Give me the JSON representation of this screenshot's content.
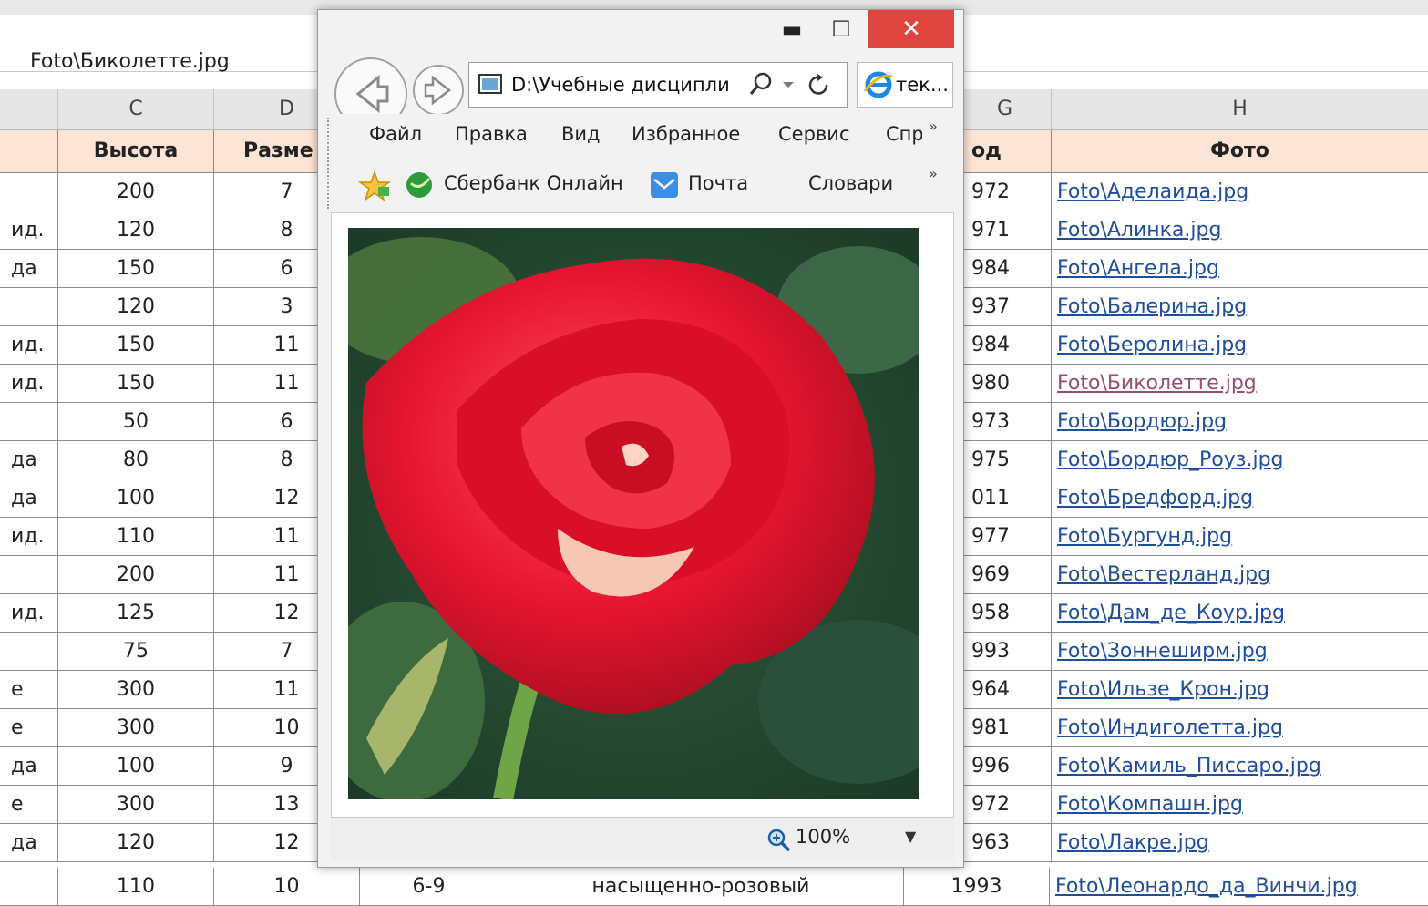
{
  "excel": {
    "formula_bar": "Foto\\Биколетте.jpg",
    "columns": [
      "C",
      "D",
      "G",
      "H"
    ],
    "headers": [
      "Высота",
      "Разме",
      "од",
      "Фото"
    ],
    "rows": [
      {
        "b": "",
        "c": "200",
        "d": "7",
        "g": "972",
        "h": "Foto\\Аделаида.jpg"
      },
      {
        "b": "ид.",
        "c": "120",
        "d": "8",
        "g": "971",
        "h": "Foto\\Алинка.jpg"
      },
      {
        "b": "да",
        "c": "150",
        "d": "6",
        "g": "984",
        "h": "Foto\\Ангела.jpg"
      },
      {
        "b": "",
        "c": "120",
        "d": "3",
        "g": "937",
        "h": "Foto\\Балерина.jpg"
      },
      {
        "b": "ид.",
        "c": "150",
        "d": "11",
        "g": "984",
        "h": "Foto\\Беролина.jpg"
      },
      {
        "b": "ид.",
        "c": "150",
        "d": "11",
        "g": "980",
        "h": "Foto\\Биколетте.jpg"
      },
      {
        "b": "",
        "c": "50",
        "d": "6",
        "g": "973",
        "h": "Foto\\Бордюр.jpg"
      },
      {
        "b": "да",
        "c": "80",
        "d": "8",
        "g": "975",
        "h": "Foto\\Бордюр_Роуз.jpg"
      },
      {
        "b": "да",
        "c": "100",
        "d": "12",
        "g": "011",
        "h": "Foto\\Бредфорд.jpg"
      },
      {
        "b": "ид.",
        "c": "110",
        "d": "11",
        "g": "977",
        "h": "Foto\\Бургунд.jpg"
      },
      {
        "b": "",
        "c": "200",
        "d": "11",
        "g": "969",
        "h": "Foto\\Вестерланд.jpg"
      },
      {
        "b": "ид.",
        "c": "125",
        "d": "12",
        "g": "958",
        "h": "Foto\\Дам_де_Коур.jpg"
      },
      {
        "b": "",
        "c": "75",
        "d": "7",
        "g": "993",
        "h": "Foto\\Зоннеширм.jpg"
      },
      {
        "b": "е",
        "c": "300",
        "d": "11",
        "g": "964",
        "h": "Foto\\Ильзе_Крон.jpg"
      },
      {
        "b": "е",
        "c": "300",
        "d": "10",
        "g": "981",
        "h": "Foto\\Индиголетта.jpg"
      },
      {
        "b": "да",
        "c": "100",
        "d": "9",
        "g": "996",
        "h": "Foto\\Камиль_Писсаро.jpg"
      },
      {
        "b": "е",
        "c": "300",
        "d": "13",
        "g": "972",
        "h": "Foto\\Компашн.jpg"
      },
      {
        "b": "да",
        "c": "120",
        "d": "12",
        "g": "963",
        "h": "Foto\\Лакре.jpg"
      }
    ],
    "last_row": {
      "c": "110",
      "d": "10",
      "e": "6-9",
      "f": "насыщенно-розовый",
      "g": "1993",
      "h": "Foto\\Леонардо_да_Винчи.jpg"
    }
  },
  "ie": {
    "address": "D:\\Учебные дисципли",
    "tab_title": "тек...",
    "menu": [
      "Файл",
      "Правка",
      "Вид",
      "Избранное",
      "Сервис",
      "Спр"
    ],
    "favorites": {
      "sberbank": "Сбербанк Онлайн",
      "mail": "Почта",
      "dictionaries": "Словари"
    },
    "zoom": "100%"
  }
}
